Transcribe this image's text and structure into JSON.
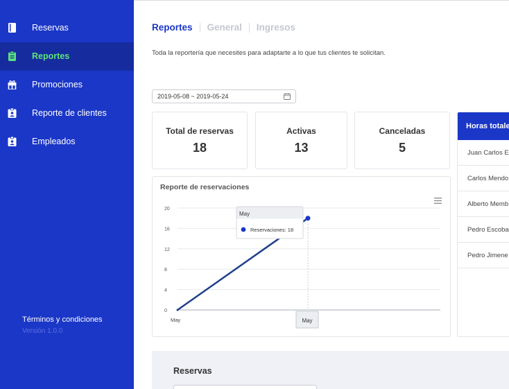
{
  "sidebar": {
    "items": [
      {
        "label": "Reservas",
        "icon": "book-icon"
      },
      {
        "label": "Reportes",
        "icon": "clipboard-icon"
      },
      {
        "label": "Promociones",
        "icon": "gift-icon"
      },
      {
        "label": "Reporte de clientes",
        "icon": "badge-icon"
      },
      {
        "label": "Empleados",
        "icon": "badge-icon"
      }
    ],
    "active": "Reportes",
    "terms": "Términos y condiciones",
    "version": "Versión 1.0.0"
  },
  "header": {
    "tabs": [
      "Reportes",
      "General",
      "Ingresos"
    ],
    "active_tab": "Reportes",
    "subtitle": "Toda la reportería que necesites para adaptarte a lo que tus clientes te solicitan."
  },
  "filter": {
    "date_range": "2019-05-08 ~ 2019-05-24"
  },
  "stats": [
    {
      "label": "Total de reservas",
      "value": "18"
    },
    {
      "label": "Activas",
      "value": "13"
    },
    {
      "label": "Canceladas",
      "value": "5"
    }
  ],
  "chart": {
    "title": "Reporte de reservaciones",
    "tooltip_title": "May",
    "tooltip_text": "Reservaciones: 18",
    "crosshair_label": "May"
  },
  "chart_data": {
    "type": "line",
    "x": [
      "May",
      "May"
    ],
    "series": [
      {
        "name": "Reservaciones",
        "values": [
          0,
          18
        ]
      }
    ],
    "yticks": [
      0,
      4,
      8,
      12,
      16,
      20
    ],
    "ylim": [
      0,
      20
    ],
    "xlabel": "",
    "ylabel": "",
    "grid": true,
    "color": "#1f3e8a",
    "marker_color": "#1b37c7"
  },
  "hours": {
    "header": "Horas totale",
    "rows": [
      "Juan Carlos E",
      "Carlos Mendo",
      "Alberto Memb",
      "Pedro Escoba",
      "Pedro Jimene"
    ]
  },
  "bottom": {
    "title": "Reservas"
  },
  "colors": {
    "primary": "#1b37c7",
    "active_text": "#5be37a",
    "sidebar_active_bg": "#162c9e"
  }
}
